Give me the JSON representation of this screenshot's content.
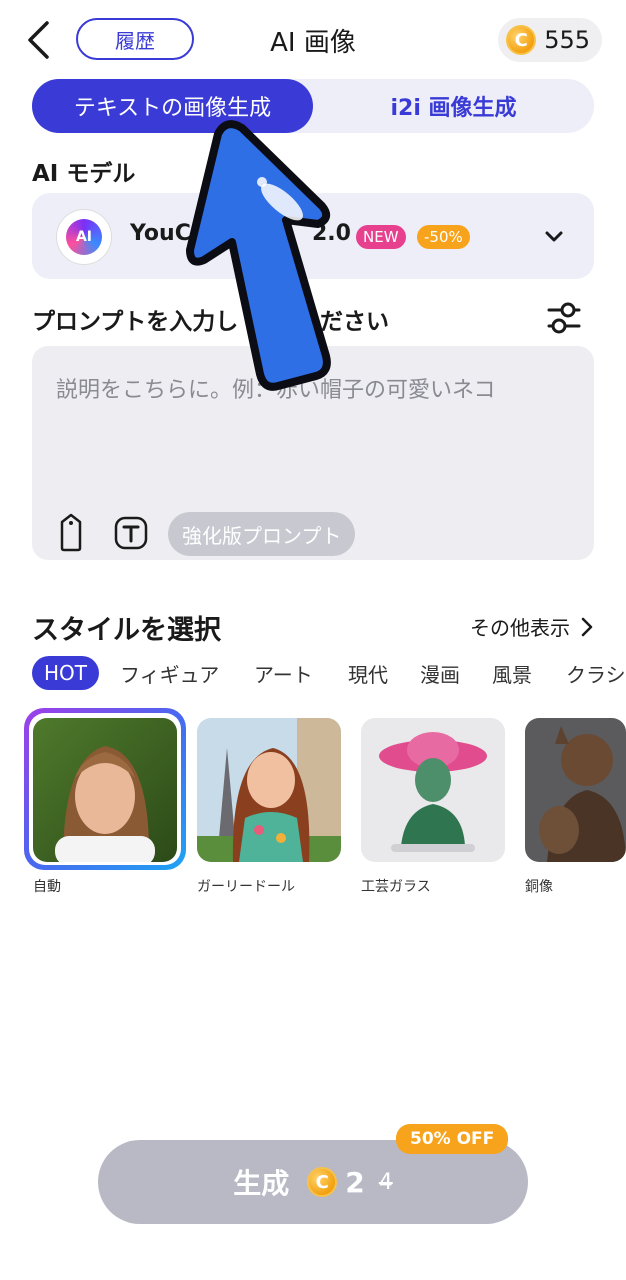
{
  "header": {
    "title": "AI 画像",
    "history_label": "履歴",
    "coin_balance": "555",
    "coin_symbol": "C"
  },
  "mode_tabs": [
    {
      "label": "テキストの画像生成",
      "active": true
    },
    {
      "label": "i2i 画像生成",
      "active": false
    }
  ],
  "model_section": {
    "label": "AI モデル",
    "model_name": "YouCa",
    "model_version": "2.0",
    "logo_text": "AI",
    "badge_new": "NEW",
    "badge_discount": "-50%"
  },
  "prompt_section": {
    "label": "プロンプトを入力し",
    "label_tail": "ださい",
    "placeholder": "説明をこちらに。例：赤い帽子の可愛いネコ",
    "enhance_label": "強化版プロンプト"
  },
  "style_section": {
    "label": "スタイルを選択",
    "more_label": "その他表示",
    "tabs": [
      "HOT",
      "フィギュア",
      "アート",
      "現代",
      "漫画",
      "風景",
      "クラシ"
    ],
    "styles": [
      {
        "label": "自動",
        "selected": true
      },
      {
        "label": "ガーリードール",
        "selected": false
      },
      {
        "label": "工芸ガラス",
        "selected": false
      },
      {
        "label": "銅像",
        "selected": false
      }
    ]
  },
  "generate": {
    "label": "生成",
    "price": "2",
    "old_price": "4",
    "offer_badge": "50% OFF"
  },
  "colors": {
    "accent": "#3a3bd6",
    "coin": "#f3a10f",
    "new_badge": "#e6408f",
    "discount_badge": "#f7a31c"
  }
}
